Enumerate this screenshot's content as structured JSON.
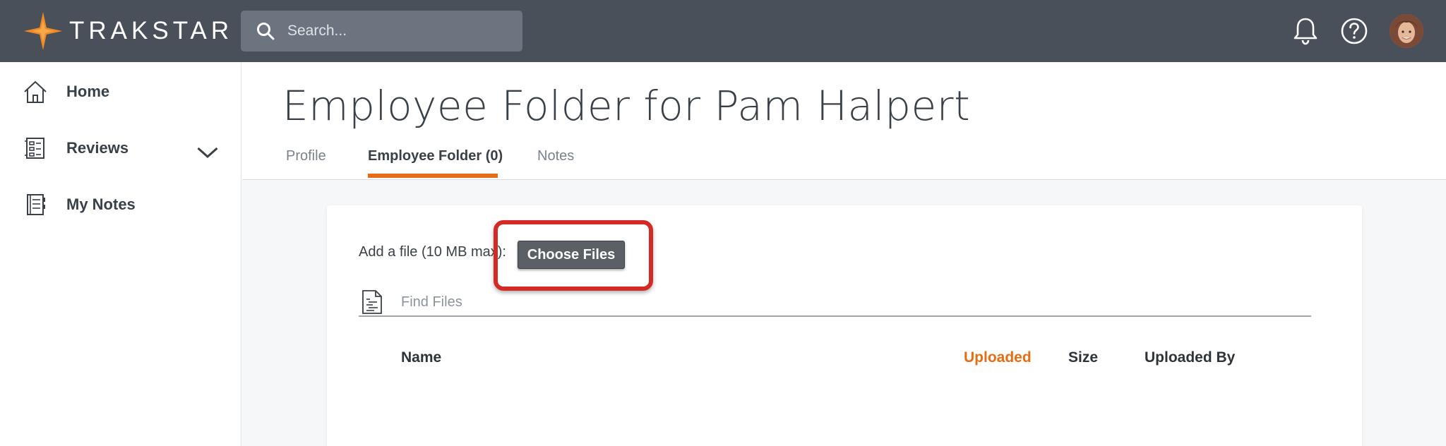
{
  "brand": {
    "name": "TRAKSTAR",
    "accent": "#e56d13"
  },
  "topbar": {
    "search_placeholder": "Search...",
    "icons": [
      "search-icon",
      "bell-icon",
      "help-icon",
      "avatar"
    ]
  },
  "sidebar": {
    "items": [
      {
        "label": "Home",
        "icon": "home-icon"
      },
      {
        "label": "Reviews",
        "icon": "reviews-icon",
        "expandable": true
      },
      {
        "label": "My Notes",
        "icon": "notes-icon"
      }
    ]
  },
  "page": {
    "title": "Employee Folder for Pam Halpert",
    "tabs": [
      {
        "label": "Profile",
        "active": false
      },
      {
        "label": "Employee Folder (0)",
        "active": true
      },
      {
        "label": "Notes",
        "active": false
      }
    ]
  },
  "upload": {
    "add_label": "Add a file (10 MB max):",
    "button_label": "Choose Files",
    "highlight_color": "#d42a26"
  },
  "files": {
    "find_placeholder": "Find Files",
    "columns": [
      {
        "label": "Name",
        "sorted": false
      },
      {
        "label": "Uploaded",
        "sorted": true
      },
      {
        "label": "Size",
        "sorted": false
      },
      {
        "label": "Uploaded By",
        "sorted": false
      }
    ]
  }
}
